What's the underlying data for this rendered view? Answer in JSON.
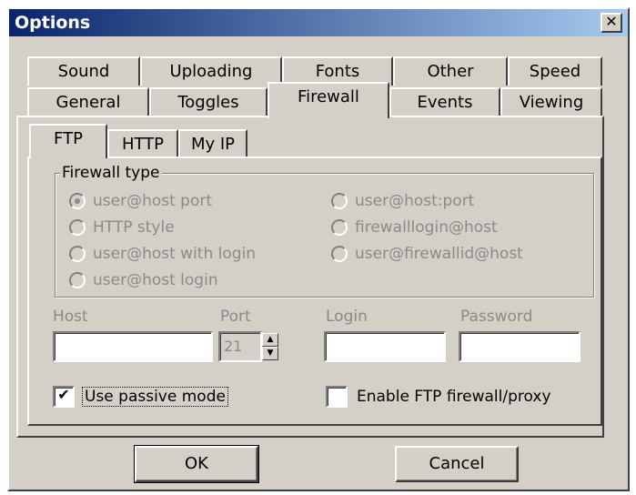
{
  "window": {
    "title": "Options",
    "close_glyph": "✕"
  },
  "tabs_row1": [
    "Sound",
    "Uploading",
    "Fonts",
    "Other",
    "Speed"
  ],
  "tabs_row2": [
    "General",
    "Toggles",
    "Firewall",
    "Events",
    "Viewing"
  ],
  "active_tab": "Firewall",
  "subtabs": [
    "FTP",
    "HTTP",
    "My IP"
  ],
  "active_subtab": "FTP",
  "firewall_type": {
    "title": "Firewall type",
    "left_options": [
      "user@host port",
      "HTTP style",
      "user@host with login",
      "user@host login"
    ],
    "right_options": [
      "user@host:port",
      "firewalllogin@host",
      "user@firewallid@host"
    ],
    "selected": "user@host port"
  },
  "fields": {
    "host_label": "Host",
    "port_label": "Port",
    "port_value": "21",
    "login_label": "Login",
    "password_label": "Password"
  },
  "checkboxes": {
    "passive_label": "Use passive mode",
    "passive_checked": true,
    "passive_mark": "✔",
    "enable_fw_label": "Enable FTP firewall/proxy",
    "enable_fw_checked": false
  },
  "buttons": {
    "ok": "OK",
    "cancel": "Cancel"
  }
}
